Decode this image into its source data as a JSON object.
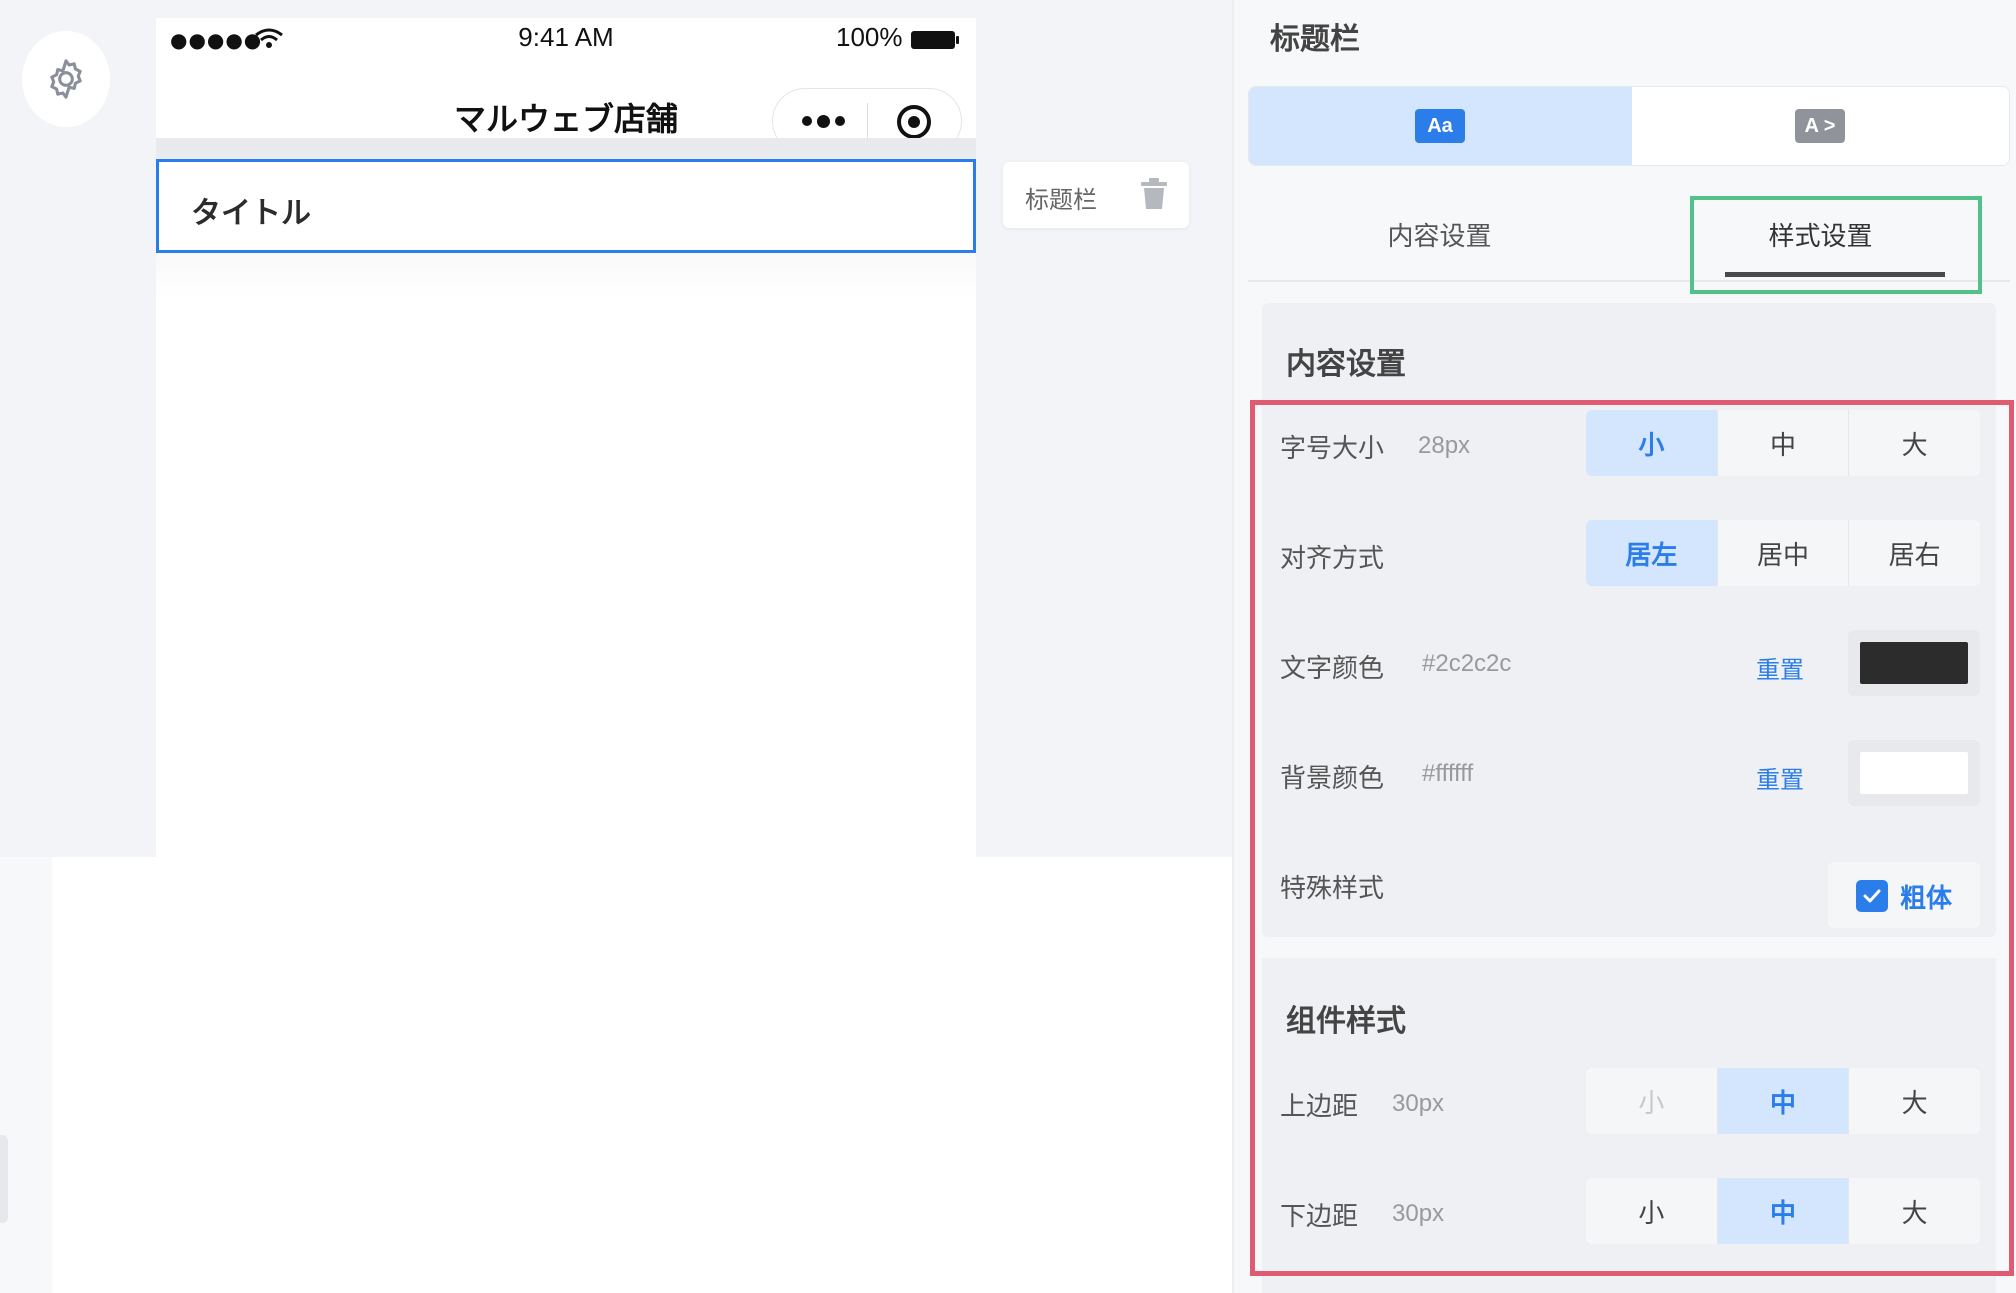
{
  "phone": {
    "status_time": "9:41 AM",
    "status_battery": "100%",
    "signal": "●●●●●",
    "nav_title": "マルウェブ店舗",
    "title_block_text": "タイトル"
  },
  "floating_label": {
    "text": "标题栏"
  },
  "panel": {
    "title": "标题栏",
    "type_options": [
      {
        "icon_text": "Aa",
        "icon_name": "text-style-icon",
        "selected": true
      },
      {
        "icon_text": "A >",
        "icon_name": "text-link-style-icon",
        "selected": false
      }
    ],
    "tabs": {
      "content": "内容设置",
      "style": "样式设置",
      "active": "style"
    },
    "content_section": {
      "title": "内容设置",
      "font_size": {
        "label": "字号大小",
        "value": "28px",
        "options": [
          "小",
          "中",
          "大"
        ],
        "selected": "小"
      },
      "align": {
        "label": "对齐方式",
        "options": [
          "居左",
          "居中",
          "居右"
        ],
        "selected": "居左"
      },
      "text_color": {
        "label": "文字颜色",
        "value": "#2c2c2c",
        "reset": "重置",
        "color": "#2c2c2c"
      },
      "bg_color": {
        "label": "背景颜色",
        "value": "#ffffff",
        "reset": "重置",
        "color": "#ffffff"
      },
      "special": {
        "label": "特殊样式",
        "option": "粗体",
        "checked": true
      }
    },
    "component_section": {
      "title": "组件样式",
      "top_margin": {
        "label": "上边距",
        "value": "30px",
        "options": [
          "小",
          "中",
          "大"
        ],
        "selected": "中"
      },
      "bottom_margin": {
        "label": "下边距",
        "value": "30px",
        "options": [
          "小",
          "中",
          "大"
        ],
        "selected": "中"
      }
    }
  },
  "colors": {
    "accent": "#2b7de9",
    "highlight_green": "#52c18a",
    "highlight_red": "#e05a71"
  }
}
